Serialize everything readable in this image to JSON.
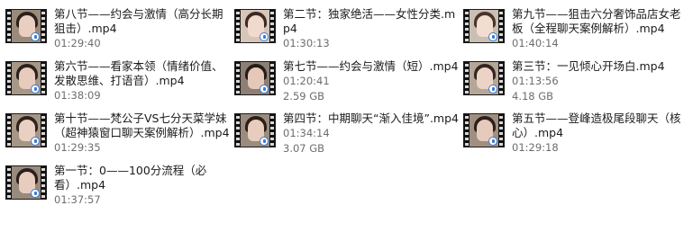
{
  "files": [
    {
      "title": "第八节——约会与激情（高分长期狙击）.mp4",
      "duration": "01:29:40",
      "size": "",
      "thumb_bg": "#9a8a7a",
      "thumb_face": "#e9cfc0",
      "thumb_hair": "#2b1f1a"
    },
    {
      "title": "第二节：独家绝活——女性分类.mp4",
      "duration": "01:30:13",
      "size": "",
      "thumb_bg": "#d7c6b8",
      "thumb_face": "#f1d9cd",
      "thumb_hair": "#3a2a24"
    },
    {
      "title": "第九节——狙击六分奢饰品店女老板（全程聊天案例解析）.mp4",
      "duration": "01:40:14",
      "size": "",
      "thumb_bg": "#c9bfb4",
      "thumb_face": "#f3ddd0",
      "thumb_hair": "#4a342a"
    },
    {
      "title": "第六节——看家本领（情绪价值、发散思维、打语音）.mp4",
      "duration": "01:38:09",
      "size": "",
      "thumb_bg": "#a79787",
      "thumb_face": "#e7cbbd",
      "thumb_hair": "#2d211c"
    },
    {
      "title": "第七节——约会与激情（短）.mp4",
      "duration": "01:20:41",
      "size": "2.59 GB",
      "thumb_bg": "#8d7f73",
      "thumb_face": "#e5c8b8",
      "thumb_hair": "#261c18"
    },
    {
      "title": "第三节：一见倾心开场白.mp4",
      "duration": "01:13:56",
      "size": "4.18 GB",
      "thumb_bg": "#b5a797",
      "thumb_face": "#edd3c6",
      "thumb_hair": "#33251f"
    },
    {
      "title": "第十节——梵公子VS七分天菜学妹（超神猿窗口聊天案例解析）.mp4",
      "duration": "01:29:35",
      "size": "",
      "thumb_bg": "#a69686",
      "thumb_face": "#ead0c2",
      "thumb_hair": "#2f231d"
    },
    {
      "title": "第四节：中期聊天“渐入佳境”.mp4",
      "duration": "01:34:14",
      "size": "3.07 GB",
      "thumb_bg": "#9b8c7e",
      "thumb_face": "#e8ccbe",
      "thumb_hair": "#2a1f1a"
    },
    {
      "title": "第五节——登峰造极尾段聊天（核心）.mp4",
      "duration": "01:29:18",
      "size": "",
      "thumb_bg": "#a08f80",
      "thumb_face": "#e6cabb",
      "thumb_hair": "#2c201b"
    },
    {
      "title": "第一节：0——100分流程（必看）.mp4",
      "duration": "01:37:57",
      "size": "",
      "thumb_bg": "#988a7c",
      "thumb_face": "#e8cdbf",
      "thumb_hair": "#2b201b"
    }
  ]
}
